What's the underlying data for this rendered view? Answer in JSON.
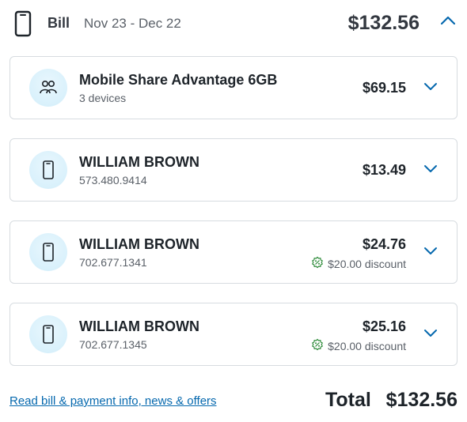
{
  "header": {
    "label": "Bill",
    "period": "Nov 23 - Dec 22",
    "total": "$132.56"
  },
  "cards": [
    {
      "title": "Mobile Share Advantage 6GB",
      "subtitle": "3 devices",
      "price": "$69.15",
      "icon": "group-icon"
    },
    {
      "title": "WILLIAM BROWN",
      "subtitle": "573.480.9414",
      "price": "$13.49",
      "icon": "phone-icon"
    },
    {
      "title": "WILLIAM BROWN",
      "subtitle": "702.677.1341",
      "price": "$24.76",
      "discount": "$20.00 discount",
      "icon": "phone-icon"
    },
    {
      "title": "WILLIAM BROWN",
      "subtitle": "702.677.1345",
      "price": "$25.16",
      "discount": "$20.00 discount",
      "icon": "phone-icon"
    }
  ],
  "footer": {
    "link_text": "Read bill & payment info, news & offers",
    "total_label": "Total",
    "total_value": "$132.56"
  },
  "colors": {
    "link": "#0568ae",
    "chevron": "#0568ae",
    "discount_icon": "#2e8b3a",
    "avatar_bg": "#d6f0fb",
    "card_border": "#d7dce0"
  }
}
